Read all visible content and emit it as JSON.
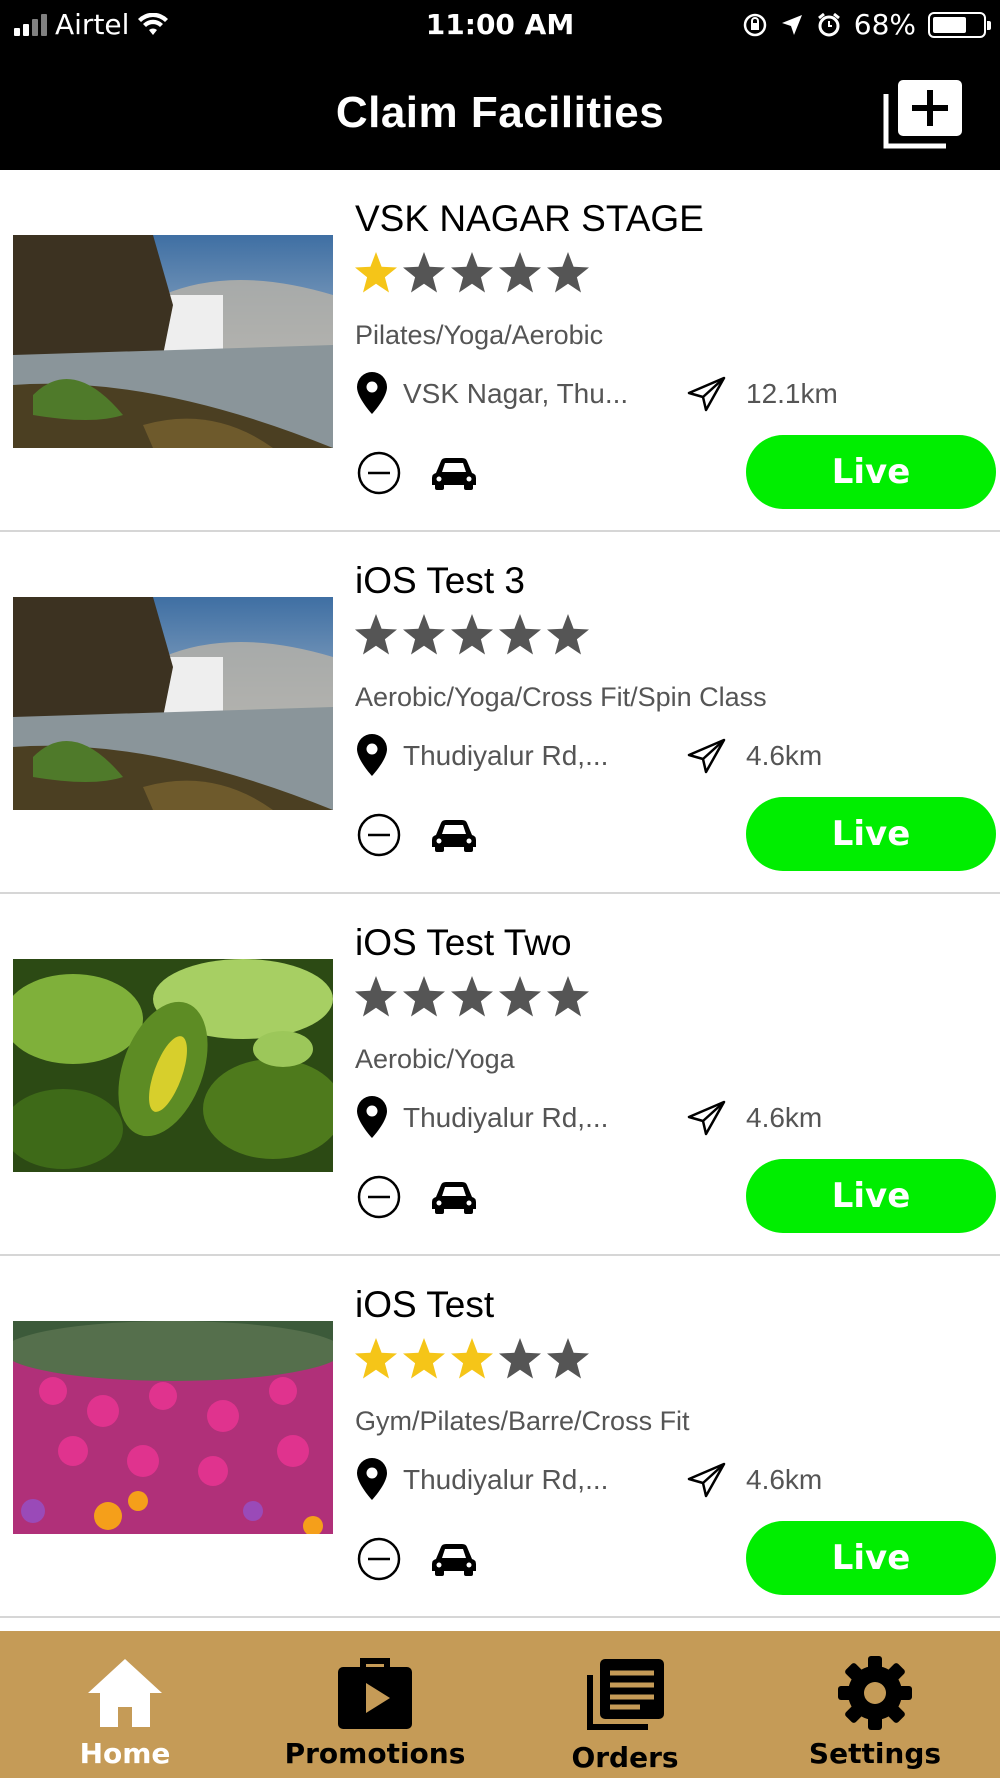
{
  "status_bar": {
    "carrier": "Airtel",
    "time": "11:00 AM",
    "battery_percent": "68%",
    "battery_level": 0.68
  },
  "header": {
    "title": "Claim Facilities",
    "add_icon": "add-square-icon"
  },
  "facilities": [
    {
      "name": "VSK NAGAR STAGE",
      "rating": 1,
      "categories": "Pilates/Yoga/Aerobic",
      "location": "VSK Nagar, Thu...",
      "distance": "12.1km",
      "status": "Live",
      "image": "waterfall"
    },
    {
      "name": "iOS Test 3",
      "rating": 0,
      "categories": "Aerobic/Yoga/Cross Fit/Spin Class",
      "location": "Thudiyalur Rd,...",
      "distance": "4.6km",
      "status": "Live",
      "image": "waterfall"
    },
    {
      "name": "iOS Test Two",
      "rating": 0,
      "categories": "Aerobic/Yoga",
      "location": "Thudiyalur Rd,...",
      "distance": "4.6km",
      "status": "Live",
      "image": "leaves"
    },
    {
      "name": "iOS Test",
      "rating": 3,
      "categories": "Gym/Pilates/Barre/Cross Fit",
      "location": "Thudiyalur Rd,...",
      "distance": "4.6km",
      "status": "Live",
      "image": "flowers"
    }
  ],
  "tabs": [
    {
      "label": "Home",
      "icon": "home-icon",
      "active": true
    },
    {
      "label": "Promotions",
      "icon": "promotions-icon",
      "active": false
    },
    {
      "label": "Orders",
      "icon": "orders-icon",
      "active": false
    },
    {
      "label": "Settings",
      "icon": "gear-icon",
      "active": false
    }
  ],
  "colors": {
    "header_bg": "#000000",
    "live_button": "#00ee00",
    "star_filled": "#f5c518",
    "star_empty": "#555555",
    "tabbar_bg": "#c59b57"
  }
}
